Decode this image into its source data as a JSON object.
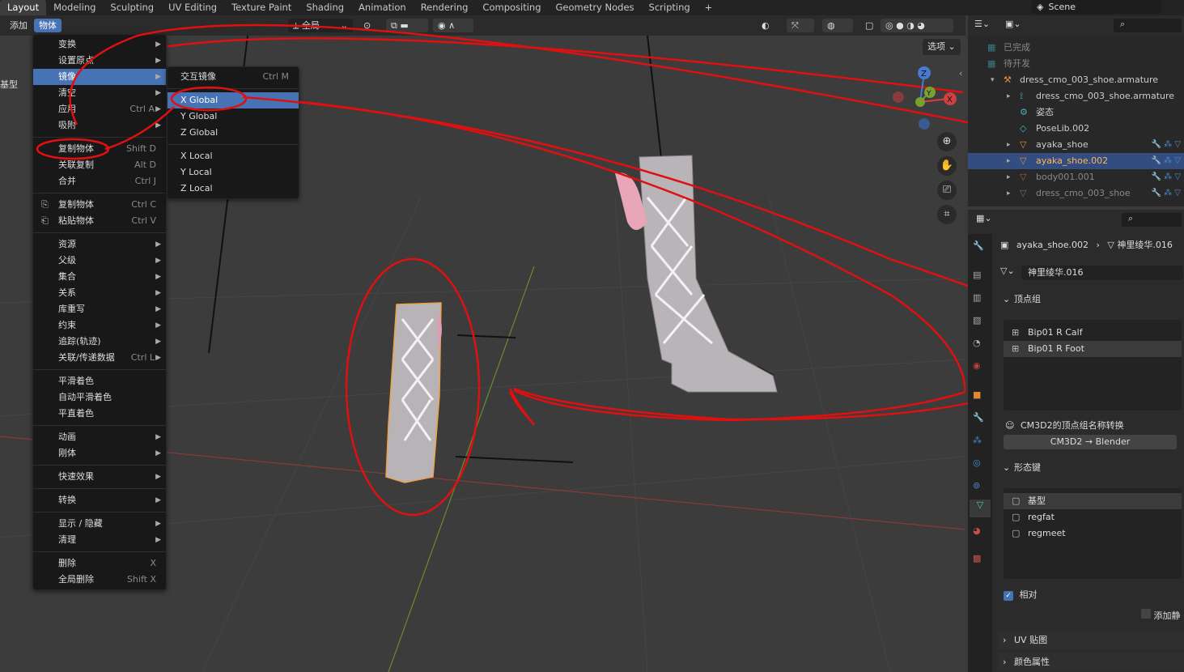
{
  "workspace_tabs": [
    "Layout",
    "Modeling",
    "Sculpting",
    "UV Editing",
    "Texture Paint",
    "Shading",
    "Animation",
    "Rendering",
    "Compositing",
    "Geometry Nodes",
    "Scripting"
  ],
  "add_tab_icon": "plus-icon",
  "scene_label": "Scene",
  "header": {
    "add_label": "添加",
    "object_label": "物体",
    "transform_space": "全局",
    "options_label": "选项"
  },
  "left_edge_label": "基型",
  "object_menu": {
    "items": [
      {
        "label": "变换",
        "submenu": true
      },
      {
        "label": "设置原点",
        "submenu": true
      },
      {
        "label": "镜像",
        "submenu": true,
        "highlighted": true
      },
      {
        "label": "清空",
        "submenu": true
      },
      {
        "label": "应用",
        "shortcut": "Ctrl A",
        "submenu": true
      },
      {
        "label": "吸附",
        "submenu": true
      },
      {
        "sep": true
      },
      {
        "label": "复制物体",
        "shortcut": "Shift D"
      },
      {
        "label": "关联复制",
        "shortcut": "Alt D"
      },
      {
        "label": "合并",
        "shortcut": "Ctrl J"
      },
      {
        "sep": true
      },
      {
        "label": "复制物体",
        "shortcut": "Ctrl C",
        "icon": "copy-icon"
      },
      {
        "label": "粘贴物体",
        "shortcut": "Ctrl V",
        "icon": "paste-icon"
      },
      {
        "sep": true
      },
      {
        "label": "资源",
        "submenu": true
      },
      {
        "label": "父级",
        "submenu": true
      },
      {
        "label": "集合",
        "submenu": true
      },
      {
        "label": "关系",
        "submenu": true
      },
      {
        "label": "库重写",
        "submenu": true
      },
      {
        "label": "约束",
        "submenu": true
      },
      {
        "label": "追踪(轨迹)",
        "submenu": true
      },
      {
        "label": "关联/传递数据",
        "shortcut": "Ctrl L",
        "submenu": true
      },
      {
        "sep": true
      },
      {
        "label": "平滑着色"
      },
      {
        "label": "自动平滑着色"
      },
      {
        "label": "平直着色"
      },
      {
        "sep": true
      },
      {
        "label": "动画",
        "submenu": true
      },
      {
        "label": "刚体",
        "submenu": true
      },
      {
        "sep": true
      },
      {
        "label": "快速效果",
        "submenu": true
      },
      {
        "sep": true
      },
      {
        "label": "转换",
        "submenu": true
      },
      {
        "sep": true
      },
      {
        "label": "显示 / 隐藏",
        "submenu": true
      },
      {
        "label": "清理",
        "submenu": true
      },
      {
        "sep": true
      },
      {
        "label": "删除",
        "shortcut": "X"
      },
      {
        "label": "全局删除",
        "shortcut": "Shift X"
      }
    ]
  },
  "mirror_submenu": {
    "items": [
      {
        "label": "交互镜像",
        "shortcut": "Ctrl M"
      },
      {
        "sep": true
      },
      {
        "label": "X Global",
        "highlighted": true
      },
      {
        "label": "Y Global"
      },
      {
        "label": "Z Global"
      },
      {
        "sep": true
      },
      {
        "label": "X Local"
      },
      {
        "label": "Y Local"
      },
      {
        "label": "Z Local"
      }
    ]
  },
  "gizmo": {
    "z": "Z",
    "x": "X",
    "y": "Y"
  },
  "outliner": {
    "rows": [
      {
        "label": "已完成",
        "indent": 0,
        "icon": "collection-icon",
        "dim": true
      },
      {
        "label": "待开发",
        "indent": 0,
        "icon": "collection-icon",
        "dim": true
      },
      {
        "label": "dress_cmo_003_shoe.armature",
        "indent": 1,
        "icon": "armature-icon"
      },
      {
        "label": "dress_cmo_003_shoe.armature",
        "indent": 2,
        "icon": "bone-icon"
      },
      {
        "label": "姿态",
        "indent": 2,
        "icon": "pose-icon"
      },
      {
        "label": "PoseLib.002",
        "indent": 2,
        "icon": "poselib-icon"
      },
      {
        "label": "ayaka_shoe",
        "indent": 2,
        "icon": "mesh-icon"
      },
      {
        "label": "ayaka_shoe.002",
        "indent": 2,
        "icon": "mesh-icon",
        "selected": true
      },
      {
        "label": "body001.001",
        "indent": 2,
        "icon": "mesh-icon",
        "dim": true
      },
      {
        "label": "dress_cmo_003_shoe",
        "indent": 2,
        "icon": "mesh-icon",
        "dim": true
      }
    ]
  },
  "properties": {
    "object_name": "ayaka_shoe.002",
    "mesh_name": "神里绫华.016",
    "mesh_field": "神里绫华.016",
    "vertex_groups_title": "顶点组",
    "vertex_groups": [
      "Bip01 R Calf",
      "Bip01 R Foot"
    ],
    "cm3d2_title": "CM3D2的顶点组名称转换",
    "cm3d2_button": "CM3D2 → Blender",
    "shape_keys_title": "形态键",
    "shape_keys": [
      "基型",
      "regfat",
      "regmeet"
    ],
    "relative_label": "相对",
    "add_rest_label": "添加静",
    "uv_maps_title": "UV 贴图",
    "color_attrs_title": "颜色属性"
  },
  "colors": {
    "accent": "#4772b3",
    "annotation": "#e01010",
    "selected_text": "#ffb45a"
  }
}
